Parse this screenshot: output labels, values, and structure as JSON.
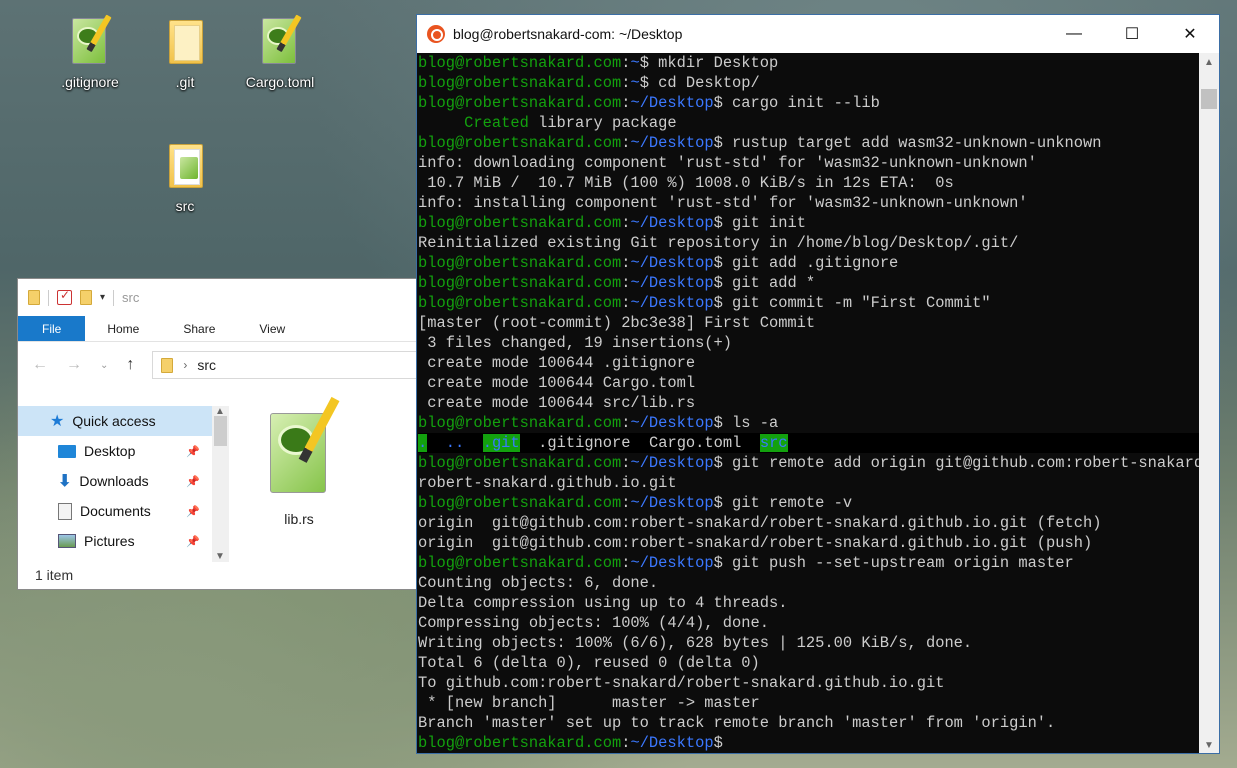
{
  "desktop": {
    "icons": [
      {
        "label": ".gitignore"
      },
      {
        "label": ".git"
      },
      {
        "label": "Cargo.toml"
      },
      {
        "label": "src"
      }
    ]
  },
  "explorer": {
    "title_path": "src",
    "ribbon_tabs": [
      "File",
      "Home",
      "Share",
      "View"
    ],
    "address_crumb": "src",
    "nav_items": [
      {
        "label": "Quick access",
        "icon": "star-icon"
      },
      {
        "label": "Desktop",
        "icon": "desktop-icon"
      },
      {
        "label": "Downloads",
        "icon": "download-icon"
      },
      {
        "label": "Documents",
        "icon": "documents-icon"
      },
      {
        "label": "Pictures",
        "icon": "pictures-icon"
      }
    ],
    "files": [
      {
        "name": "lib.rs"
      }
    ],
    "status": "1 item"
  },
  "terminal": {
    "title": "blog@robertsnakard-com: ~/Desktop",
    "user": "blog@robertsnakard.com",
    "lines": [
      {
        "path": "~",
        "cmd": "$ mkdir Desktop"
      },
      {
        "path": "~",
        "cmd": "$ cd Desktop/"
      },
      {
        "path": "~/Desktop",
        "cmd": "$ cargo init --lib"
      },
      {
        "out_created": "     Created",
        "out": " library package"
      },
      {
        "path": "~/Desktop",
        "cmd": "$ rustup target add wasm32-unknown-unknown"
      },
      {
        "out": "info: downloading component 'rust-std' for 'wasm32-unknown-unknown'"
      },
      {
        "out": " 10.7 MiB /  10.7 MiB (100 %) 1008.0 KiB/s in 12s ETA:  0s"
      },
      {
        "out": "info: installing component 'rust-std' for 'wasm32-unknown-unknown'"
      },
      {
        "path": "~/Desktop",
        "cmd": "$ git init"
      },
      {
        "out": "Reinitialized existing Git repository in /home/blog/Desktop/.git/"
      },
      {
        "path": "~/Desktop",
        "cmd": "$ git add .gitignore"
      },
      {
        "path": "~/Desktop",
        "cmd": "$ git add *"
      },
      {
        "path": "~/Desktop",
        "cmd": "$ git commit -m \"First Commit\""
      },
      {
        "out": "[master (root-commit) 2bc3e38] First Commit"
      },
      {
        "out": " 3 files changed, 19 insertions(+)"
      },
      {
        "out": " create mode 100644 .gitignore"
      },
      {
        "out": " create mode 100644 Cargo.toml"
      },
      {
        "out": " create mode 100644 src/lib.rs"
      },
      {
        "path": "~/Desktop",
        "cmd": "$ ls -a"
      },
      {
        "ls": true
      },
      {
        "path": "~/Desktop",
        "cmd": "$ git remote add origin git@github.com:robert-snakard/"
      },
      {
        "out": "robert-snakard.github.io.git"
      },
      {
        "path": "~/Desktop",
        "cmd": "$ git remote -v"
      },
      {
        "out": "origin  git@github.com:robert-snakard/robert-snakard.github.io.git (fetch)"
      },
      {
        "out": "origin  git@github.com:robert-snakard/robert-snakard.github.io.git (push)"
      },
      {
        "path": "~/Desktop",
        "cmd": "$ git push --set-upstream origin master"
      },
      {
        "out": "Counting objects: 6, done."
      },
      {
        "out": "Delta compression using up to 4 threads."
      },
      {
        "out": "Compressing objects: 100% (4/4), done."
      },
      {
        "out": "Writing objects: 100% (6/6), 628 bytes | 125.00 KiB/s, done."
      },
      {
        "out": "Total 6 (delta 0), reused 0 (delta 0)"
      },
      {
        "out": "To github.com:robert-snakard/robert-snakard.github.io.git"
      },
      {
        "out": " * [new branch]      master -> master"
      },
      {
        "out": "Branch 'master' set up to track remote branch 'master' from 'origin'."
      },
      {
        "path": "~/Desktop",
        "cmd": "$"
      }
    ],
    "ls_entries": [
      ".",
      "..",
      ".git",
      ".gitignore",
      "Cargo.toml",
      "src"
    ]
  },
  "colors": {
    "user_prompt": "#13a10e",
    "path": "#3b78ff",
    "ribbon_file": "#1979ca",
    "ubuntu": "#e95420"
  }
}
